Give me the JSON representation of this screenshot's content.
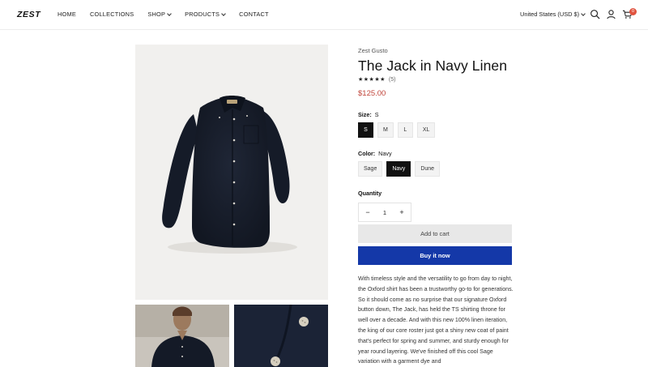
{
  "header": {
    "logo": "ZEST",
    "nav": [
      {
        "label": "HOME",
        "has_dropdown": false
      },
      {
        "label": "COLLECTIONS",
        "has_dropdown": false
      },
      {
        "label": "SHOP",
        "has_dropdown": true
      },
      {
        "label": "PRODUCTS",
        "has_dropdown": true
      },
      {
        "label": "CONTACT",
        "has_dropdown": false
      }
    ],
    "currency": "United States (USD $)",
    "icons": [
      "search-icon",
      "account-icon",
      "cart-icon"
    ],
    "cart_count": "0",
    "badge_color": "#e0533f"
  },
  "product": {
    "vendor": "Zest Gusto",
    "title": "The Jack in Navy Linen",
    "stars": "★★★★★",
    "review_count": "(5)",
    "price": "$125.00",
    "price_color": "#c0453a",
    "size": {
      "label": "Size:",
      "selected": "S",
      "options": [
        "S",
        "M",
        "L",
        "XL"
      ]
    },
    "color": {
      "label": "Color:",
      "selected": "Navy",
      "options": [
        "Sage",
        "Navy",
        "Dune"
      ]
    },
    "quantity": {
      "label": "Quantity",
      "value": "1",
      "minus": "−",
      "plus": "+"
    },
    "add_to_cart": "Add to cart",
    "buy_now": "Buy it now",
    "buy_color": "#1438a8",
    "description": "With timeless style and the versatility to go from day to night, the Oxford shirt has been a trustworthy go-to for generations. So it should come as no surprise that our signature Oxford button down, The Jack, has held the TS shirting throne for well over a decade. And with this new 100% linen iteration, the king of our core roster just got a shiny new coat of paint that's perfect for spring and summer, and sturdy enough for year round layering. We've finished off this cool Sage variation with a garment dye and"
  }
}
